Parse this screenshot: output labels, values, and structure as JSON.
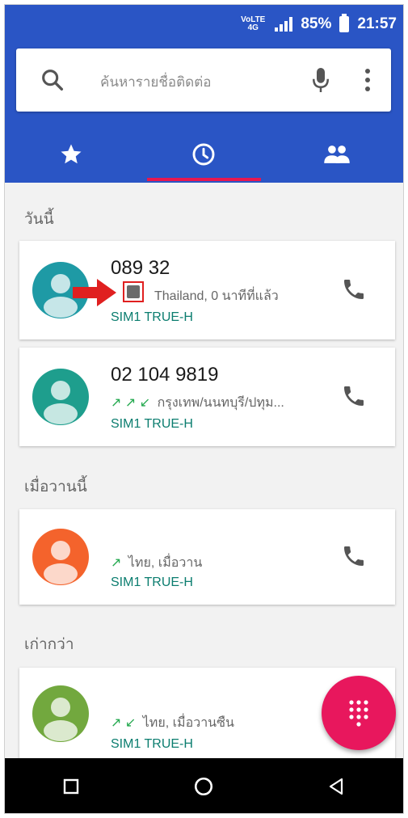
{
  "status_bar": {
    "network_top": "VoLTE",
    "network_bottom": "4G",
    "battery": "85%",
    "time": "21:57"
  },
  "search": {
    "placeholder": "ค้นหารายชื่อติดต่อ",
    "icons": [
      "search-icon",
      "microphone-icon",
      "more-vert-icon"
    ]
  },
  "tabs": [
    {
      "name": "favorites",
      "icon": "star-icon",
      "active": false
    },
    {
      "name": "recents",
      "icon": "clock-icon",
      "active": true
    },
    {
      "name": "contacts",
      "icon": "people-icon",
      "active": false
    }
  ],
  "sections": {
    "today": "วันนี้",
    "yesterday": "เมื่อวานนี้",
    "older": "เก่ากว่า"
  },
  "calls": [
    {
      "name": "089            32",
      "arrows": "",
      "detail": "Thailand, 0 นาทีที่แล้ว",
      "sim": "SIM1 TRUE-H",
      "avatar_color": "#1e9aa5"
    },
    {
      "name": "02 104 9819",
      "arrows": "↗ ↗ ↙",
      "detail": "กรุงเทพ/นนทบุรี/ปทุม...",
      "sim": "SIM1 TRUE-H",
      "avatar_color": "#1e9e8d"
    },
    {
      "name": "",
      "arrows": "↗",
      "detail": "ไทย, เมื่อวาน",
      "sim": "SIM1 TRUE-H",
      "avatar_color": "#f4632c"
    },
    {
      "name": "",
      "arrows": "↗ ↙",
      "detail": "ไทย, เมื่อวานซืน",
      "sim": "SIM1 TRUE-H",
      "avatar_color": "#72a83e"
    }
  ],
  "colors": {
    "header": "#2a55c5",
    "tab_indicator": "#e8174f",
    "fab": "#e8175d",
    "sim_text": "#0b7d6f"
  },
  "fab_icon": "dialpad-icon",
  "nav": [
    "recent-apps-icon",
    "home-icon",
    "back-icon"
  ]
}
